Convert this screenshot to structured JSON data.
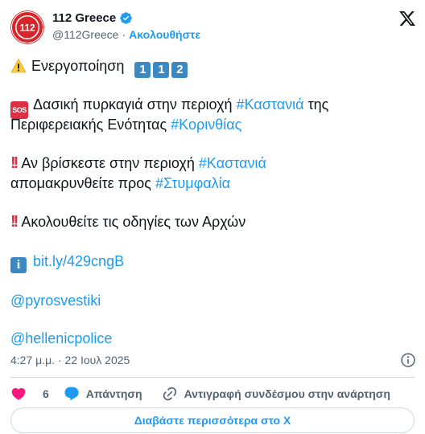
{
  "account": {
    "name": "112 Greece",
    "handle": "@112Greece",
    "separator": "·",
    "follow_label": "Ακολουθήστε",
    "avatar_text": "112",
    "avatar_ring_text": "ΓΕΝΙΚΗ ΓΡΑΜΜΑΤΕΙΑ ΠΟΛΙΤΙΚΗΣ ΠΡΟΣΤΑΣΙΑΣ"
  },
  "tweet": {
    "line1": {
      "text": "Ενεργοποίηση",
      "keycaps": [
        "1",
        "1",
        "2"
      ],
      "icon": "warning-icon"
    },
    "line2": {
      "icon_text": "SOS",
      "text": "Δασική πυρκαγιά στην περιοχή",
      "hashtag": "#Καστανιά",
      "text_after": "της"
    },
    "line3": {
      "text": "Περιφερειακής Ενότητας",
      "hashtag": "#Κορινθίας"
    },
    "line4": {
      "icon_text": "!!",
      "text": "Αν βρίσκεστε στην περιοχή",
      "hashtag": "#Καστανιά"
    },
    "line5": {
      "text": "απομακρυνθείτε προς",
      "hashtag": "#Στυμφαλία"
    },
    "line6": {
      "icon_text": "!!",
      "text": "Ακολουθείτε τις οδηγίες των Αρχών"
    },
    "line7": {
      "icon_text": "i",
      "link": "bit.ly/429cngB"
    },
    "line8": {
      "mention": "@pyrosvestiki"
    },
    "line9": {
      "mention": "@hellenicpolice"
    },
    "timestamp": "4:27 μ.μ. · 22 Ιουλ 2025"
  },
  "actions": {
    "like_count": "6",
    "reply_label": "Απάντηση",
    "copy_link_label": "Αντιγραφή συνδέσμου στην ανάρτηση"
  },
  "read_more_label": "Διαβάστε περισσότερα στο X",
  "colors": {
    "accent": "#1d9bf0",
    "text": "#0f1419",
    "muted": "#536471",
    "border": "#cfd9de",
    "like": "#f91880",
    "avatar_red": "#d7262b"
  }
}
